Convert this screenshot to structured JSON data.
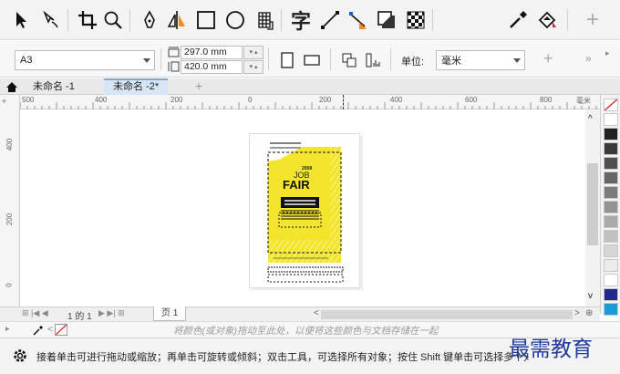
{
  "toolbar": {
    "icons": [
      "pick-tool-icon",
      "shape-tool-icon",
      "crop-tool-icon",
      "zoom-tool-icon",
      "pen-tool-icon",
      "artistic-media-icon",
      "rectangle-tool-icon",
      "ellipse-tool-icon",
      "table-tool-icon",
      "text-tool-icon",
      "line-tool-icon",
      "connector-tool-icon",
      "drop-shadow-tool-icon",
      "transparency-tool-icon",
      "eyedropper-tool-icon",
      "fill-tool-icon",
      "add-tool-icon"
    ],
    "text_tool_glyph": "字"
  },
  "propbar": {
    "paper_size": "A3",
    "width_value": "297.0 mm",
    "height_value": "420.0 mm",
    "units_label": "单位:",
    "units_value": "毫米"
  },
  "tabs": {
    "doc1": "未命名 -1",
    "doc2": "未命名 -2*"
  },
  "ruler": {
    "h_labels": [
      "500",
      "400",
      "200",
      "0",
      "200",
      "400",
      "600",
      "800"
    ],
    "unit": "毫米",
    "v_labels": [
      "400",
      "200",
      "0"
    ]
  },
  "poster": {
    "year": "2008",
    "line1": "JOB",
    "line2": "FAIR"
  },
  "pagebar": {
    "page_counter": "1 的 1",
    "page_tab": "页 1"
  },
  "hint_bar": {
    "text": "将颜色(或对象)拖动至此处，以便将这些颜色与文档存储在一起"
  },
  "status": {
    "text": "接着单击可进行拖动或缩放；再单击可旋转或倾斜；双击工具，可选择所有对象；按住 Shift 键单击可选择多个对象；",
    "watermark": "最需教育"
  },
  "colors": {
    "accent": "#f2e52b",
    "palette": [
      "#ffffff",
      "#222222",
      "#3a3a3a",
      "#505050",
      "#666666",
      "#7c7c7c",
      "#939393",
      "#aaaaaa",
      "#c0c0c0",
      "#d6d6d6",
      "#ececec",
      "#ffffff",
      "#1f2a8a",
      "#1c9bd8"
    ]
  }
}
